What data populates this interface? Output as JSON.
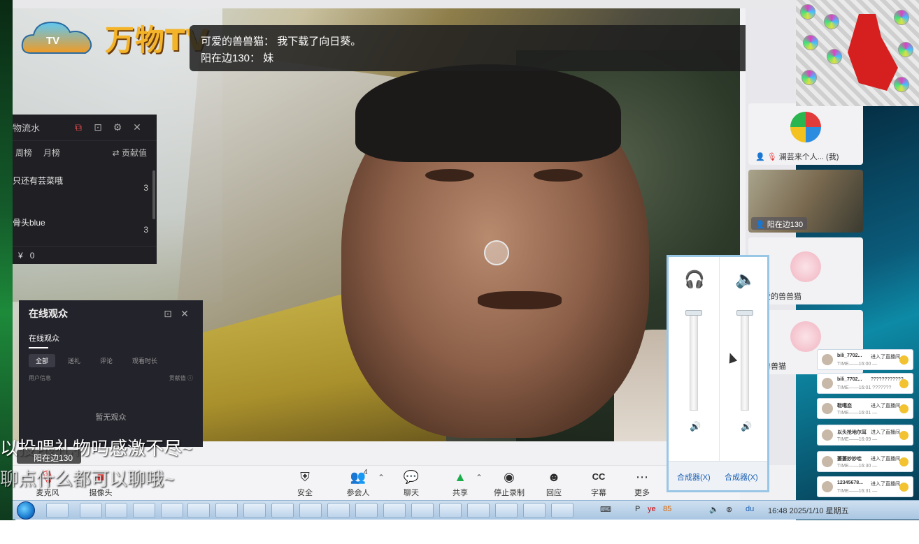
{
  "brand": {
    "tv_badge": "TV",
    "name": "万物TV"
  },
  "chat": [
    {
      "user": "可爱的兽兽猫",
      "text": "我下载了向日葵。"
    },
    {
      "user": "阳在边130",
      "text": "妹"
    }
  ],
  "gift_panel": {
    "title": "物流水",
    "tabs": [
      "周榜",
      "月榜"
    ],
    "sort_label": "⇄ 贡献值",
    "rows": [
      {
        "name": "只还有芸菜哦",
        "count": "3"
      },
      {
        "name": "骨头blue",
        "count": "3"
      }
    ],
    "total_symbol": "¥",
    "total": "0"
  },
  "audience_panel": {
    "title": "在线观众",
    "subtab": "在线观众",
    "filters": [
      "全部",
      "送礼",
      "评论",
      "观看时长"
    ],
    "col_left": "用户信息",
    "col_right": "贡献值 ⓘ",
    "empty": "暂无观众"
  },
  "overlay_captions": {
    "line1": "以投喂礼物吗感激不尽~",
    "line2": "聊点什么都可以聊哦~",
    "presenter_name": "阳在边130"
  },
  "toolbar": {
    "items": [
      {
        "key": "mic",
        "label": "麦克风",
        "icon": "mic-muted-icon"
      },
      {
        "key": "camera",
        "label": "摄像头",
        "icon": "camera-off-icon"
      },
      {
        "key": "security",
        "label": "安全",
        "icon": "shield-icon"
      },
      {
        "key": "participants",
        "label": "参会人",
        "icon": "people-icon",
        "badge": "4"
      },
      {
        "key": "chat",
        "label": "聊天",
        "icon": "chat-icon"
      },
      {
        "key": "share",
        "label": "共享",
        "icon": "share-screen-icon"
      },
      {
        "key": "stop_record",
        "label": "停止录制",
        "icon": "stop-record-icon"
      },
      {
        "key": "react",
        "label": "回应",
        "icon": "emoji-icon"
      },
      {
        "key": "captions",
        "label": "字幕",
        "icon": "cc-icon"
      },
      {
        "key": "more",
        "label": "更多",
        "icon": "more-icon"
      }
    ]
  },
  "participants": [
    {
      "name": "澜芸来个人...",
      "suffix": "(我)"
    },
    {
      "name": "阳在边130"
    },
    {
      "name": "可爱的兽兽猫"
    },
    {
      "name": "的兽兽猫"
    }
  ],
  "mixer": {
    "left_label": "合成器(X)",
    "right_label": "合成器(X)"
  },
  "notifications": [
    {
      "name": "bili_7702...",
      "msg": "进入了直播间",
      "time": "TIME——16:00 —"
    },
    {
      "name": "bili_7702...",
      "msg": "????????????",
      "time": "TIME——16:01 ???????"
    },
    {
      "name": "鞋噶恋",
      "msg": "进入了直播间",
      "time": "TIME——16:01 —"
    },
    {
      "name": "以头抢地尔耳",
      "msg": "进入了直播间",
      "time": "TIME——16:09 —"
    },
    {
      "name": "萋萋妙妙哇",
      "msg": "进入了直播间",
      "time": "TIME——16:30 —"
    },
    {
      "name": "12345678...",
      "msg": "进入了直播间",
      "time": "TIME——16:31 —"
    }
  ],
  "taskbar": {
    "datetime": "16:48 2025/1/10 星期五",
    "tray_items": [
      "P",
      "ye",
      "85",
      "du"
    ]
  },
  "colors": {
    "accent_green": "#1aad4a",
    "danger_red": "#e23b3b",
    "brand_gold": "#f3b42a",
    "panel_dark": "#1f1f24"
  }
}
